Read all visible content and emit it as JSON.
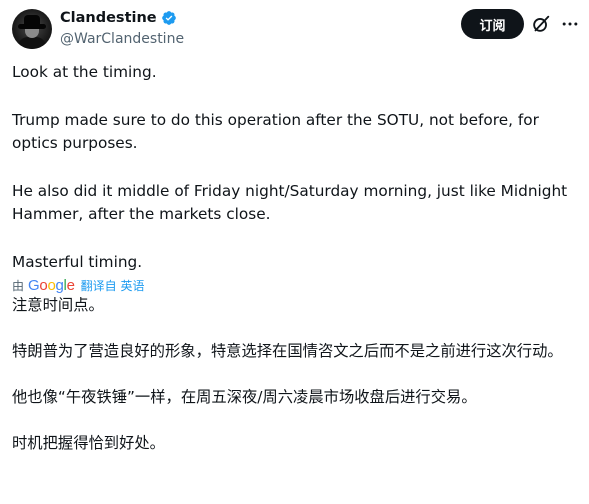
{
  "author": {
    "display_name": "Clandestine",
    "handle": "@WarClandestine",
    "verified_badge_color": "#1d9bf0"
  },
  "actions": {
    "subscribe_label": "订阅",
    "grok_icon": "grok-icon",
    "more_icon": "more-icon"
  },
  "original_paragraphs": [
    "Look at the timing.",
    "Trump made sure to do this operation after the SOTU, not before, for optics purposes.",
    "He also did it middle of Friday night/Saturday morning, just like Midnight Hammer, after the markets close.",
    "Masterful timing."
  ],
  "translation": {
    "by_label": "由",
    "provider": "Google",
    "link_label": "翻译自 英语",
    "provider_colors": [
      "#4285F4",
      "#EA4335",
      "#FBBC05",
      "#4285F4",
      "#34A853",
      "#EA4335"
    ]
  },
  "translated_paragraphs": [
    "注意时间点。",
    "特朗普为了营造良好的形象，特意选择在国情咨文之后而不是之前进行这次行动。",
    "他也像“午夜铁锤”一样，在周五深夜/周六凌晨市场收盘后进行交易。",
    "时机把握得恰到好处。"
  ]
}
